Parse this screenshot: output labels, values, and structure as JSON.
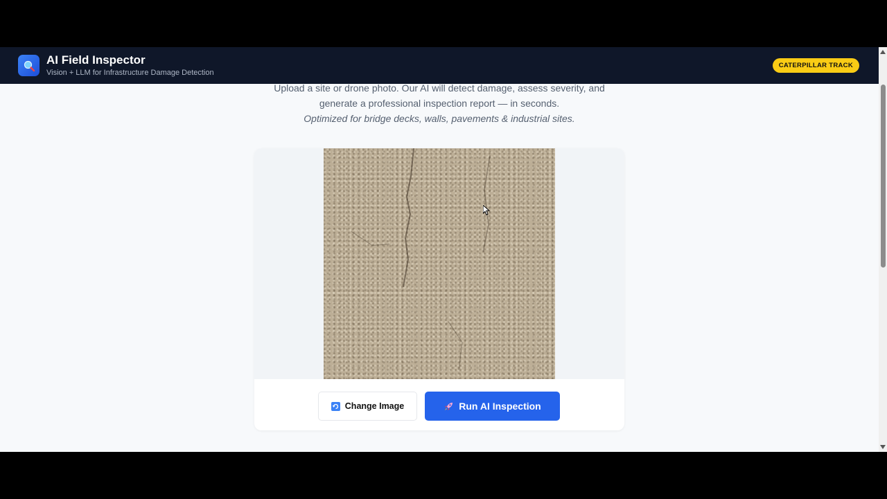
{
  "header": {
    "title": "AI Field Inspector",
    "subtitle": "Vision + LLM for Infrastructure Damage Detection",
    "badge": "CATERPILLAR TRACK",
    "logo_icon": "search-icon"
  },
  "intro": {
    "line1": "Upload a site or drone photo. Our AI will detect damage, assess severity, and",
    "line2": "generate a professional inspection report — in seconds.",
    "line3": "Optimized for bridge decks, walls, pavements & industrial sites."
  },
  "actions": {
    "change_label": "Change Image",
    "change_icon": "refresh-icon",
    "run_label": "Run AI Inspection",
    "run_icon": "rocket-icon"
  },
  "colors": {
    "header_bg": "#0f1729",
    "accent": "#2563eb",
    "badge": "#facc15"
  }
}
